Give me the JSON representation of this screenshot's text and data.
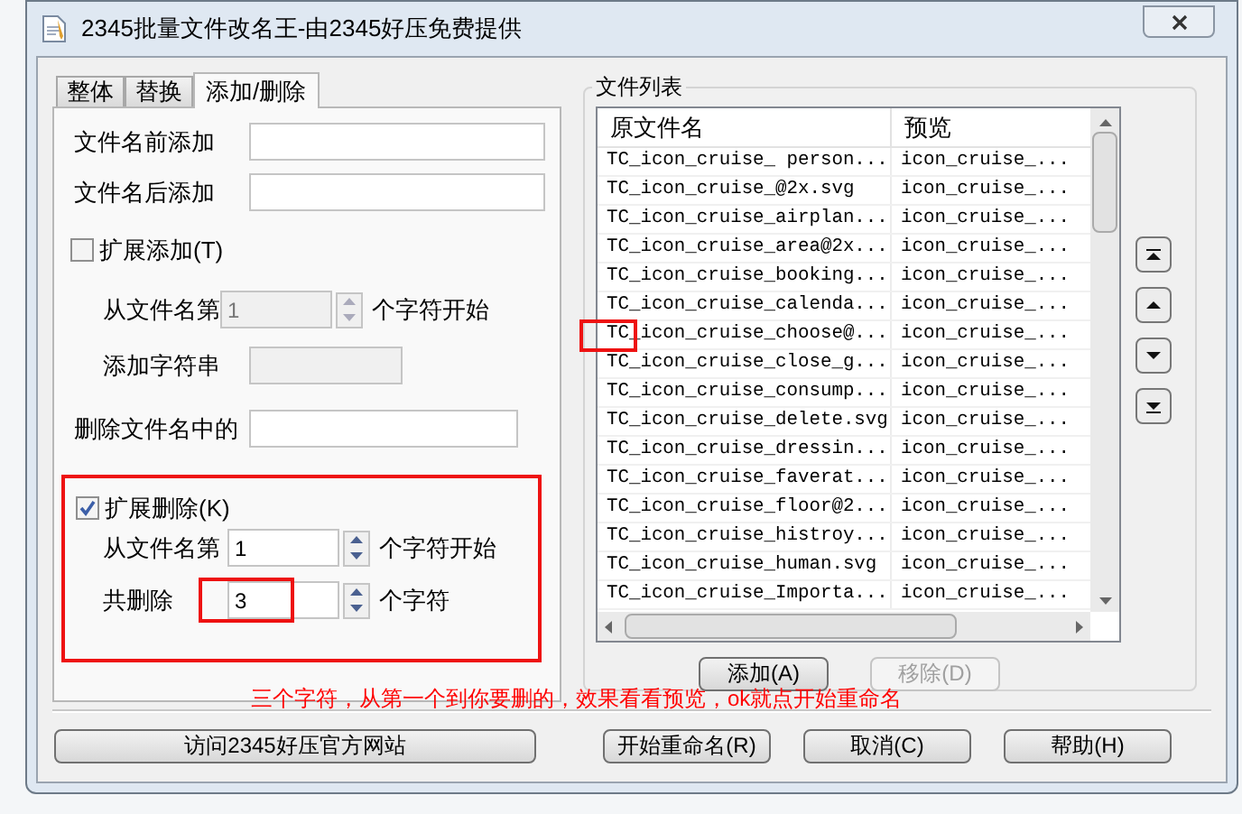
{
  "window": {
    "title": "2345批量文件改名王-由2345好压免费提供"
  },
  "tabs": [
    {
      "label": "整体",
      "selected": false
    },
    {
      "label": "替换",
      "selected": false
    },
    {
      "label": "添加/删除",
      "selected": true
    }
  ],
  "form": [
    {
      "kind": "text",
      "label": "文件名前添加",
      "disabled": false
    },
    {
      "kind": "text",
      "label": "文件名后添加",
      "disabled": false
    },
    {
      "kind": "checkbox",
      "label": "扩展添加(T)",
      "checked": false
    },
    {
      "kind": "spin",
      "label": "从文件名第",
      "value": "1",
      "suffix": "个字符开始",
      "disabled": true
    },
    {
      "kind": "text",
      "label": "添加字符串",
      "disabled": true
    },
    {
      "kind": "text",
      "label": "删除文件名中的",
      "disabled": false
    }
  ],
  "extended_delete": {
    "label": "扩展删除(K)",
    "checked": true,
    "rows": [
      {
        "label": "从文件名第",
        "value": "1",
        "suffix": "个字符开始",
        "highlighted": false
      },
      {
        "label": "共删除",
        "value": "3",
        "suffix": "个字符",
        "highlighted": true
      }
    ]
  },
  "file_list": {
    "title": "文件列表",
    "columns": [
      "原文件名",
      "预览"
    ],
    "rows": [
      {
        "original": "TC_icon_cruise_ person...",
        "preview": "icon_cruise_...",
        "highlighted": false
      },
      {
        "original": "TC_icon_cruise_@2x.svg",
        "preview": "icon_cruise_...",
        "highlighted": false
      },
      {
        "original": "TC_icon_cruise_airplan...",
        "preview": "icon_cruise_...",
        "highlighted": false
      },
      {
        "original": "TC_icon_cruise_area@2x...",
        "preview": "icon_cruise_...",
        "highlighted": false
      },
      {
        "original": "TC_icon_cruise_booking...",
        "preview": "icon_cruise_...",
        "highlighted": false
      },
      {
        "original": "TC_icon_cruise_calenda...",
        "preview": "icon_cruise_...",
        "highlighted": false
      },
      {
        "original": "TC_icon_cruise_choose@...",
        "preview": "icon_cruise_...",
        "highlighted": true
      },
      {
        "original": "TC_icon_cruise_close_g...",
        "preview": "icon_cruise_...",
        "highlighted": false
      },
      {
        "original": "TC_icon_cruise_consump...",
        "preview": "icon_cruise_...",
        "highlighted": false
      },
      {
        "original": "TC_icon_cruise_delete.svg",
        "preview": "icon_cruise_...",
        "highlighted": false
      },
      {
        "original": "TC_icon_cruise_dressin...",
        "preview": "icon_cruise_...",
        "highlighted": false
      },
      {
        "original": "TC_icon_cruise_faverat...",
        "preview": "icon_cruise_...",
        "highlighted": false
      },
      {
        "original": "TC_icon_cruise_floor@2...",
        "preview": "icon_cruise_...",
        "highlighted": false
      },
      {
        "original": "TC_icon_cruise_histroy...",
        "preview": "icon_cruise_...",
        "highlighted": false
      },
      {
        "original": "TC_icon_cruise_human.svg",
        "preview": "icon_cruise_...",
        "highlighted": false
      },
      {
        "original": "TC_icon_cruise_Importa...",
        "preview": "icon_cruise_...",
        "highlighted": false
      }
    ],
    "list_buttons": [
      {
        "label": "添加(A)",
        "disabled": false
      },
      {
        "label": "移除(D)",
        "disabled": true
      }
    ]
  },
  "annotation": "三个字符，从第一个到你要删的，效果看看预览，ok就点开始重命名",
  "bottom_buttons": [
    {
      "label": "访问2345好压官方网站"
    },
    {
      "label": "开始重命名(R)"
    },
    {
      "label": "取消(C)"
    },
    {
      "label": "帮助(H)"
    }
  ]
}
